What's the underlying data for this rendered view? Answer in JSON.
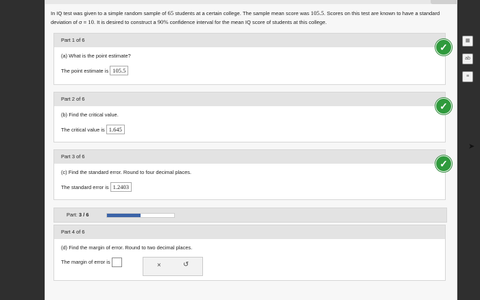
{
  "problem_text_prefix": "In IQ test was given to a simple random sample of ",
  "sample_size": "65",
  "problem_text_mid": " students at a certain college. The sample mean score was ",
  "sample_mean": "105.5",
  "problem_text_mid2": ". Scores on this test are known to have a standard deviation of σ = ",
  "sigma": "10",
  "problem_text_mid3": ". It is desired to construct a ",
  "confidence": "90%",
  "problem_text_end": " confidence interval for the mean IQ score of students at this college.",
  "parts": [
    {
      "header": "Part 1 of 6",
      "question": "(a) What is the point estimate?",
      "prompt": "The point estimate is",
      "answer": "105.5"
    },
    {
      "header": "Part 2 of 6",
      "question": "(b) Find the critical value.",
      "prompt": "The critical value is",
      "answer": "1.645"
    },
    {
      "header": "Part 3 of 6",
      "question": "(c) Find the standard error. Round to four decimal places.",
      "prompt": "The standard error is",
      "answer": "1.2403"
    }
  ],
  "progress": {
    "label_prefix": "Part:",
    "label_value": "3 / 6",
    "fraction": 0.5
  },
  "part4": {
    "header": "Part 4 of 6",
    "question": "(d) Find the margin of error. Round to two decimal places.",
    "prompt": "The margin of error is"
  },
  "tools": {
    "clear_glyph": "×",
    "undo_glyph": "↺"
  },
  "colors": {
    "check": "#2f9a3c",
    "progress_fill": "#3c64a8"
  }
}
